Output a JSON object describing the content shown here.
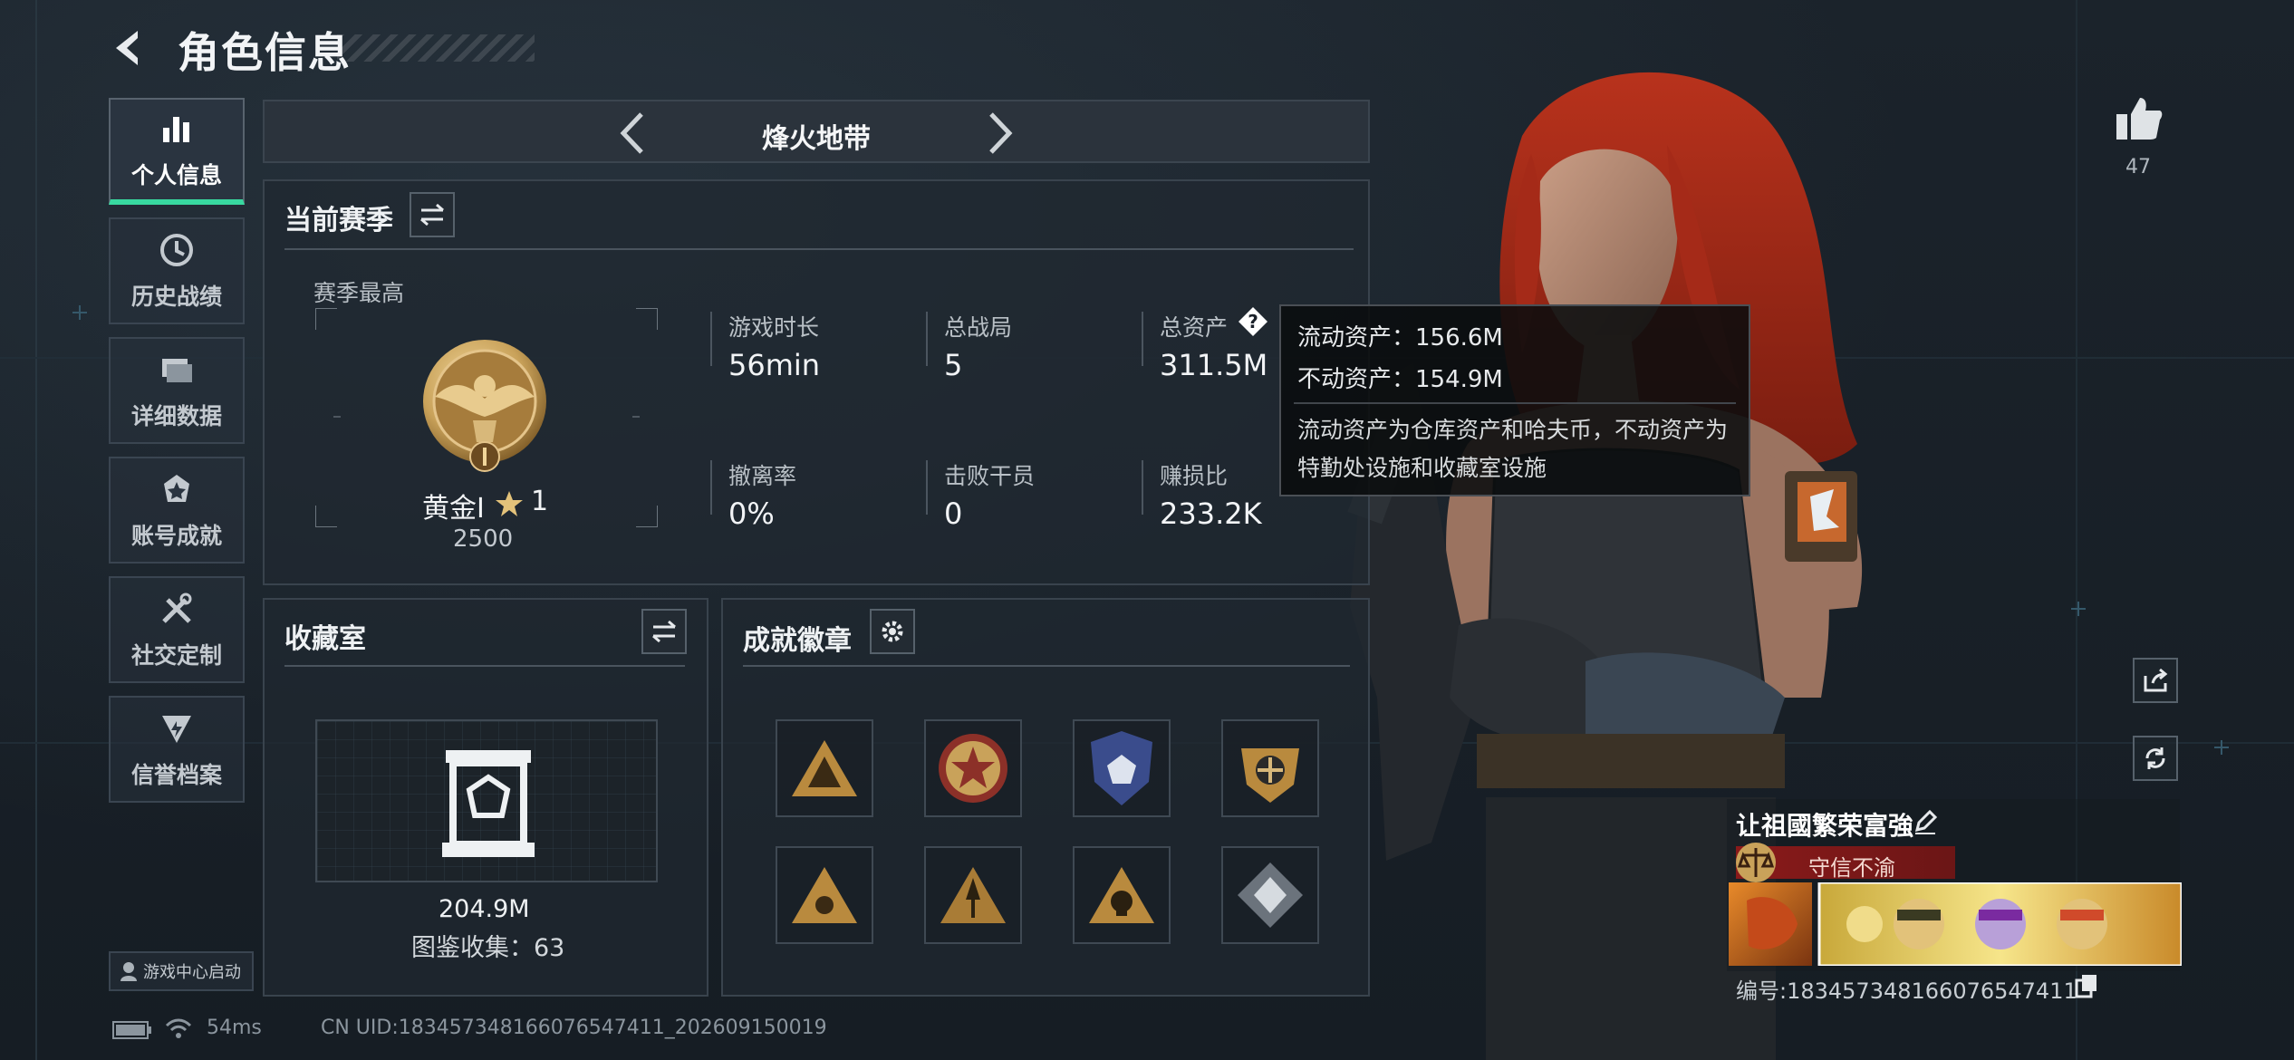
{
  "header": {
    "title": "角色信息"
  },
  "nav": [
    {
      "label": "个人信息",
      "icon": "bar-chart-icon",
      "active": true
    },
    {
      "label": "历史战绩",
      "icon": "clock-icon",
      "active": false
    },
    {
      "label": "详细数据",
      "icon": "folders-icon",
      "active": false
    },
    {
      "label": "账号成就",
      "icon": "achievement-icon",
      "active": false
    },
    {
      "label": "社交定制",
      "icon": "tools-icon",
      "active": false
    },
    {
      "label": "信誉档案",
      "icon": "credit-shield-icon",
      "active": false
    }
  ],
  "zone": {
    "name": "烽火地带"
  },
  "season": {
    "title": "当前赛季",
    "best_label": "赛季最高",
    "rank_name": "黄金I",
    "rank_stars": "1",
    "rank_score": "2500",
    "stats": [
      {
        "label": "游戏时长",
        "value": "56min"
      },
      {
        "label": "总战局",
        "value": "5"
      },
      {
        "label": "总资产",
        "value": "311.5M"
      },
      {
        "label": "撤离率",
        "value": "0%"
      },
      {
        "label": "击败干员",
        "value": "0"
      },
      {
        "label": "赚损比",
        "value": "233.2K"
      }
    ]
  },
  "tooltip": {
    "liquid": "流动资产：156.6M",
    "fixed": "不动资产：154.9M",
    "desc": "流动资产为仓库资产和哈夫币，不动资产为特勤处设施和收藏室设施"
  },
  "collection": {
    "title": "收藏室",
    "value": "204.9M",
    "catalog": "图鉴收集：63"
  },
  "badges": {
    "title": "成就徽章",
    "items": [
      "triangle-badge-icon",
      "star-medal-icon",
      "blue-shield-badge-icon",
      "gold-wing-badge-icon",
      "triangle-eye-badge-icon",
      "arrow-badge-icon",
      "skull-badge-icon",
      "diamond-badge-icon"
    ]
  },
  "launch": {
    "label": "游戏中心启动"
  },
  "status": {
    "ping": "54ms",
    "uid": "CN UID:18345734816607654741​1_202609150019"
  },
  "likes": {
    "count": "47"
  },
  "player": {
    "name": "让祖國繁荣富強",
    "title": "守信不渝",
    "uid": "编号:18345734816607654741​1"
  },
  "colors": {
    "accent": "#38d9a0",
    "banner": "#8a1a1a",
    "gold": "#c9a25a"
  }
}
